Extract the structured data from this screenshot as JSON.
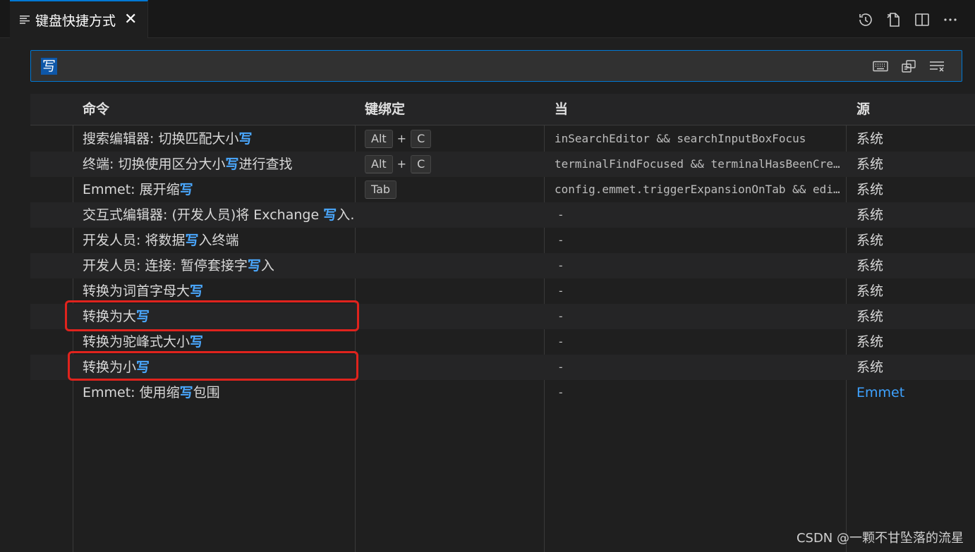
{
  "tab": {
    "label": "键盘快捷方式",
    "close": "✕"
  },
  "header_actions": [
    "history-icon",
    "open-json-icon",
    "split-editor-icon",
    "more-actions-icon"
  ],
  "search": {
    "query": "写"
  },
  "search_tools": [
    "keyboard-icon",
    "sort-by-precedence-icon",
    "clear-search-icon"
  ],
  "columns": {
    "command": "命令",
    "keybinding": "键绑定",
    "when": "当",
    "source": "源"
  },
  "rows": [
    {
      "cmd_pre": "搜索编辑器: 切换匹配大小",
      "cmd_hl": "写",
      "cmd_post": "",
      "keys": [
        "Alt",
        "C"
      ],
      "when": "inSearchEditor && searchInputBoxFocus",
      "source": "系统"
    },
    {
      "cmd_pre": "终端: 切换使用区分大小",
      "cmd_hl": "写",
      "cmd_post": "进行查找",
      "keys": [
        "Alt",
        "C"
      ],
      "when": "terminalFindFocused && terminalHasBeenCre…",
      "source": "系统"
    },
    {
      "cmd_pre": "Emmet: 展开缩",
      "cmd_hl": "写",
      "cmd_post": "",
      "keys": [
        "Tab"
      ],
      "when": "config.emmet.triggerExpansionOnTab && edi…",
      "source": "系统"
    },
    {
      "cmd_pre": "交互式编辑器: (开发人员)将 Exchange ",
      "cmd_hl": "写",
      "cmd_post": "入…",
      "keys": [],
      "when": "-",
      "source": "系统"
    },
    {
      "cmd_pre": "开发人员: 将数据",
      "cmd_hl": "写",
      "cmd_post": "入终端",
      "keys": [],
      "when": "-",
      "source": "系统"
    },
    {
      "cmd_pre": "开发人员: 连接: 暂停套接字",
      "cmd_hl": "写",
      "cmd_post": "入",
      "keys": [],
      "when": "-",
      "source": "系统"
    },
    {
      "cmd_pre": "转换为词首字母大",
      "cmd_hl": "写",
      "cmd_post": "",
      "keys": [],
      "when": "-",
      "source": "系统"
    },
    {
      "cmd_pre": "转换为大",
      "cmd_hl": "写",
      "cmd_post": "",
      "keys": [],
      "when": "-",
      "source": "系统"
    },
    {
      "cmd_pre": "转换为驼峰式大小",
      "cmd_hl": "写",
      "cmd_post": "",
      "keys": [],
      "when": "-",
      "source": "系统"
    },
    {
      "cmd_pre": "转换为小",
      "cmd_hl": "写",
      "cmd_post": "",
      "keys": [],
      "when": "-",
      "source": "系统"
    },
    {
      "cmd_pre": "Emmet: 使用缩",
      "cmd_hl": "写",
      "cmd_post": "包围",
      "keys": [],
      "when": "-",
      "source": "Emmet"
    }
  ],
  "watermark": "CSDN @一颗不甘坠落的流星",
  "colors": {
    "accent": "#0078d4",
    "highlight": "#4aa8ff",
    "annotation": "#e0231d"
  }
}
